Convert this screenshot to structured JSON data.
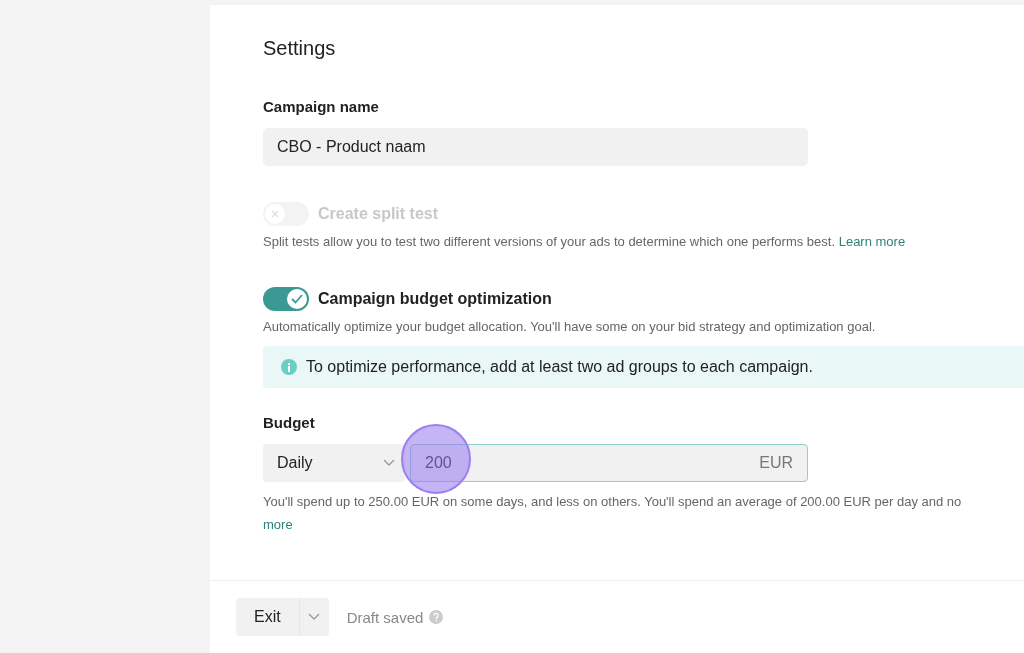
{
  "settings": {
    "title": "Settings",
    "campaign_name": {
      "label": "Campaign name",
      "value": "CBO - Product naam"
    },
    "toggles": [
      {
        "label": "Create split test",
        "on": false,
        "disabled": true,
        "description": "Split tests allow you to test two different versions of your ads to determine which one performs best.",
        "link": "Learn more"
      },
      {
        "label": "Campaign budget optimization",
        "on": true,
        "disabled": false,
        "description": "Automatically optimize your budget allocation. You'll have some on your bid strategy and optimization goal."
      }
    ],
    "info_banner": "To optimize performance, add at least two ad groups to each campaign.",
    "budget": {
      "label": "Budget",
      "period": "Daily",
      "value": "200",
      "currency": "EUR",
      "help": "You'll spend up to 250.00 EUR on some days, and less on others. You'll spend an average of 200.00 EUR per day and no",
      "link": "more"
    }
  },
  "footer": {
    "exit_button": "Exit",
    "status": "Draft saved"
  }
}
